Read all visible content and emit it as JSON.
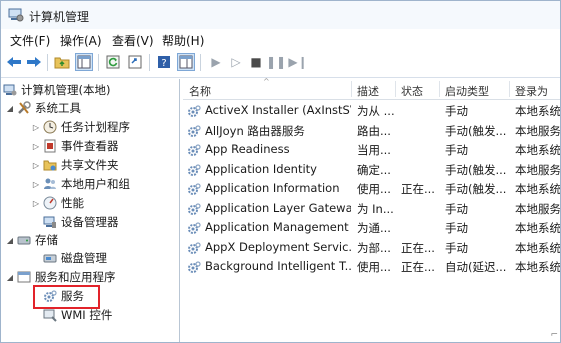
{
  "window": {
    "title": "计算机管理"
  },
  "menu": [
    "文件(F)",
    "操作(A)",
    "查看(V)",
    "帮助(H)"
  ],
  "toolbar": {
    "icons": [
      "back-arrow-icon",
      "forward-arrow-icon",
      "folder-up-icon",
      "show-hide-tree-icon",
      "refresh-icon",
      "export-list-icon",
      "help-icon",
      "properties-icon",
      "start-service-icon",
      "start-paused-icon",
      "stop-service-icon",
      "pause-service-icon",
      "restart-service-icon"
    ]
  },
  "tree": {
    "root": "计算机管理(本地)",
    "system_tools": "系统工具",
    "items": [
      "任务计划程序",
      "事件查看器",
      "共享文件夹",
      "本地用户和组",
      "性能",
      "设备管理器"
    ],
    "storage": "存储",
    "disk": "磁盘管理",
    "services_apps": "服务和应用程序",
    "services": "服务",
    "wmi": "WMI 控件"
  },
  "table": {
    "columns": [
      "名称",
      "描述",
      "状态",
      "启动类型",
      "登录为"
    ],
    "rows": [
      [
        "ActiveX Installer (AxInstSV)",
        "为从 ...",
        "",
        "手动",
        "本地系统"
      ],
      [
        "AllJoyn 路由器服务",
        "路由...",
        "",
        "手动(触发...",
        "本地服务"
      ],
      [
        "App Readiness",
        "当用...",
        "",
        "手动",
        "本地系统"
      ],
      [
        "Application Identity",
        "确定...",
        "",
        "手动(触发...",
        "本地服务"
      ],
      [
        "Application Information",
        "使用...",
        "正在...",
        "手动(触发...",
        "本地系统"
      ],
      [
        "Application Layer Gatewa...",
        "为 In...",
        "",
        "手动",
        "本地服务"
      ],
      [
        "Application Management",
        "为通...",
        "",
        "手动",
        "本地系统"
      ],
      [
        "AppX Deployment Servic...",
        "为部...",
        "正在...",
        "手动",
        "本地系统"
      ],
      [
        "Background Intelligent T...",
        "使用...",
        "正在...",
        "自动(延迟...",
        "本地系统"
      ]
    ]
  },
  "colors": {
    "accent": "#1f6fc9",
    "highlight_box": "#e2232a"
  }
}
